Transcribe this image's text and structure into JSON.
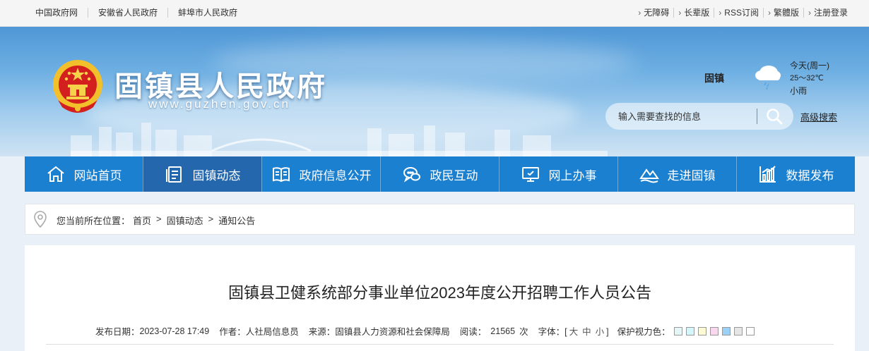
{
  "topbar": {
    "left_links": [
      "中国政府网",
      "安徽省人民政府",
      "蚌埠市人民政府"
    ],
    "right_links": [
      "无障碍",
      "长辈版",
      "RSS订阅",
      "繁體版",
      "注册登录"
    ]
  },
  "header": {
    "site_title": "固镇县人民政府",
    "site_url": "www.guzhen.gov.cn"
  },
  "weather": {
    "city": "固镇",
    "day": "今天(周一)",
    "temp": "25～32℃",
    "condition": "小雨",
    "icon": "cloud-rain-icon"
  },
  "search": {
    "placeholder": "输入需要查找的信息",
    "advanced_label": "高级搜索"
  },
  "nav": {
    "items": [
      {
        "label": "网站首页",
        "icon": "home-icon"
      },
      {
        "label": "固镇动态",
        "icon": "document-icon",
        "active": true
      },
      {
        "label": "政府信息公开",
        "icon": "book-icon"
      },
      {
        "label": "政民互动",
        "icon": "chat-icon"
      },
      {
        "label": "网上办事",
        "icon": "monitor-icon"
      },
      {
        "label": "走进固镇",
        "icon": "landscape-icon"
      },
      {
        "label": "数据发布",
        "icon": "bar-chart-icon"
      }
    ],
    "colors": {
      "bar": "#1c80d0",
      "active": "#2467ad"
    }
  },
  "breadcrumb": {
    "prefix": "您当前所在位置：",
    "items": [
      "首页",
      "固镇动态",
      "通知公告"
    ],
    "separator": ">"
  },
  "article": {
    "title": "固镇县卫健系统部分事业单位2023年度公开招聘工作人员公告",
    "meta": {
      "date_label": "发布日期：",
      "date": "2023-07-28 17:49",
      "author_label": "作者：",
      "author": "人社局信息员",
      "source_label": "来源：",
      "source": "固镇县人力资源和社会保障局",
      "reads_label": "阅读：",
      "reads": "21565",
      "reads_unit": "次",
      "font_label": "字体：",
      "font_sizes": [
        "大",
        "中",
        "小"
      ],
      "eye_label": "保护视力色：",
      "eye_colors": [
        "#e4f6f6",
        "#d4f7fb",
        "#fdfbd3",
        "#fbd6ef",
        "#9bd0f7",
        "#e6e6e6",
        "#ffffff"
      ]
    }
  }
}
